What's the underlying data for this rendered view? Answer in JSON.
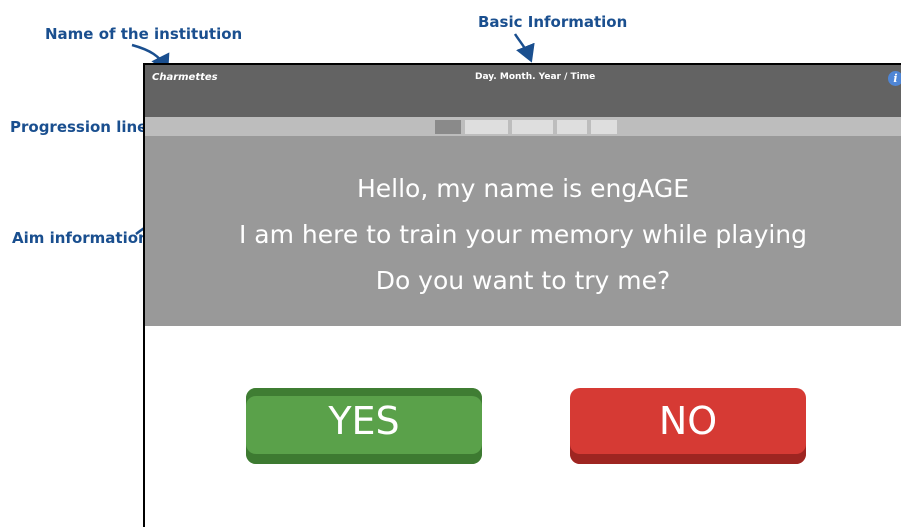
{
  "annotations": {
    "institution": "Name of the institution",
    "basic_info": "Basic Information",
    "progression": "Progression line",
    "aim": "Aim information"
  },
  "header": {
    "institution_name": "Charmettes",
    "basic_info": "Day. Month. Year / Time",
    "info_icon": "info-icon"
  },
  "progress": {
    "segments": 5,
    "current": 1
  },
  "aim": {
    "lines": [
      "Hello, my name is engAGE",
      "I am here to train your memory while playing",
      "Do you want to try me?"
    ]
  },
  "buttons": {
    "yes_label": "YES",
    "no_label": "NO"
  },
  "colors": {
    "annotation": "#1a4f8f",
    "header_bg": "#636363",
    "aim_bg": "#999999",
    "yes": "#5aa14a",
    "no": "#d63a34",
    "info": "#4f86d6"
  }
}
